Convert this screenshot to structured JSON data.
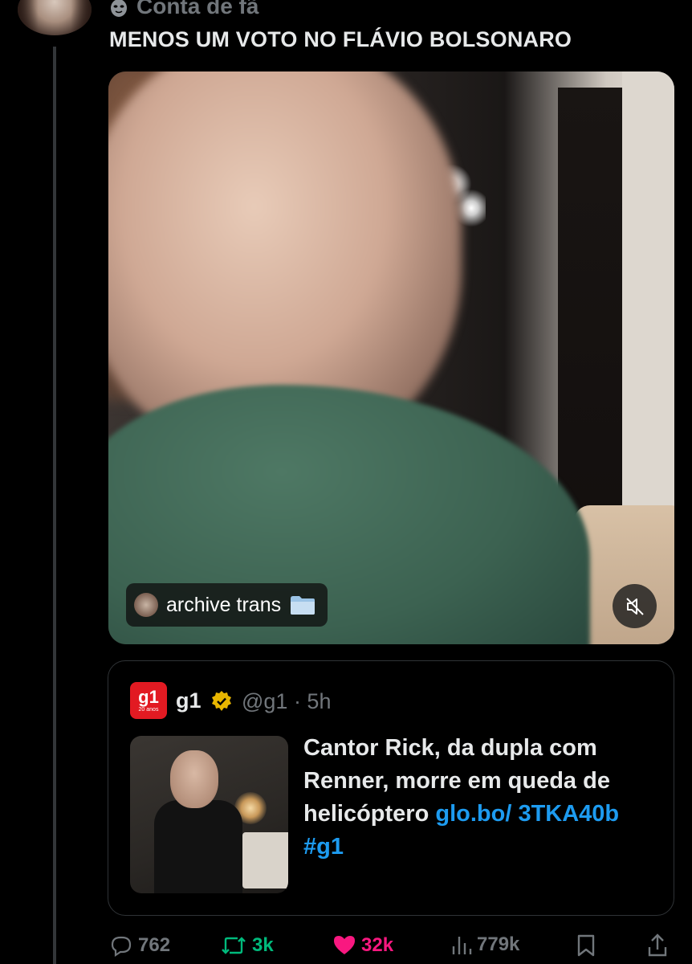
{
  "post": {
    "header_name": "Conta de fã",
    "text": "MENOS UM VOTO NO FLÁVIO BOLSONARO"
  },
  "video": {
    "chip_label": "archive trans",
    "chip_emoji": "📁",
    "mute_icon": "speaker-muted-icon"
  },
  "quote": {
    "logo_text": "g1",
    "logo_sub": "20 anos",
    "name": "g1",
    "handle_time": "@g1 · 5h",
    "text": "Cantor Rick, da dupla com Renner, morre em queda de helicóptero ",
    "link": "glo.bo/ 3TKA40b",
    "hashtag": "#g1"
  },
  "actions": {
    "replies": "762",
    "reposts": "3k",
    "likes": "32k",
    "views": "779k",
    "colors": {
      "muted": "#71767b",
      "repost": "#00ba7c",
      "like": "#f91880",
      "link": "#1d9bf0"
    }
  }
}
